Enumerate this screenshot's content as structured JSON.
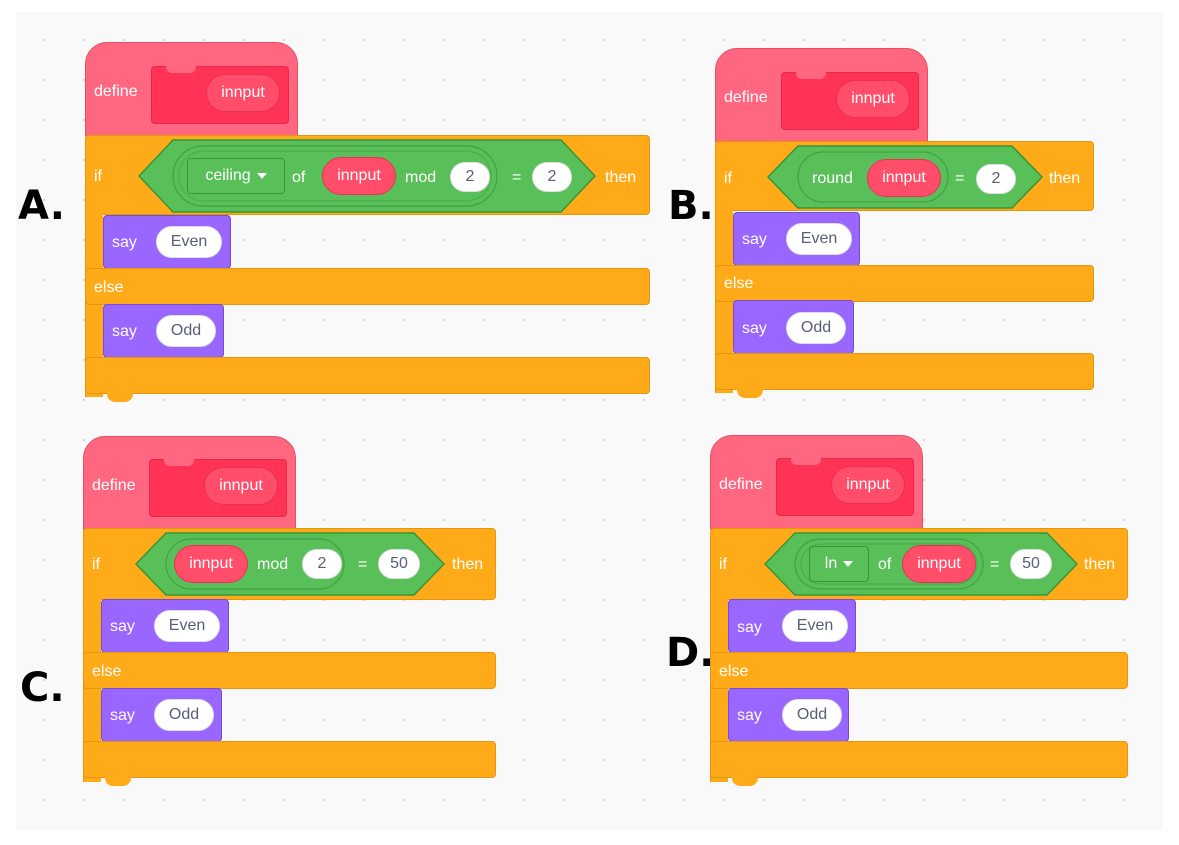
{
  "options": [
    {
      "letter": "A.",
      "define": "define",
      "param": "innput",
      "if": "if",
      "then": "then",
      "else": "else",
      "say1": "say",
      "even": "Even",
      "say2": "say",
      "odd": "Odd",
      "cond": {
        "func": "ceiling",
        "of": "of",
        "arg": "innput",
        "mod": "mod",
        "modval": "2",
        "eq": "=",
        "rhs": "2"
      }
    },
    {
      "letter": "B.",
      "define": "define",
      "param": "innput",
      "if": "if",
      "then": "then",
      "else": "else",
      "say1": "say",
      "even": "Even",
      "say2": "say",
      "odd": "Odd",
      "cond": {
        "func": "round",
        "arg": "innput",
        "eq": "=",
        "rhs": "2"
      }
    },
    {
      "letter": "C.",
      "define": "define",
      "param": "innput",
      "if": "if",
      "then": "then",
      "else": "else",
      "say1": "say",
      "even": "Even",
      "say2": "say",
      "odd": "Odd",
      "cond": {
        "arg": "innput",
        "mod": "mod",
        "modval": "2",
        "eq": "=",
        "rhs": "50"
      }
    },
    {
      "letter": "D.",
      "define": "define",
      "param": "innput",
      "if": "if",
      "then": "then",
      "else": "else",
      "say1": "say",
      "even": "Even",
      "say2": "say",
      "odd": "Odd",
      "cond": {
        "func": "ln",
        "of": "of",
        "arg": "innput",
        "eq": "=",
        "rhs": "50"
      }
    }
  ],
  "colors": {
    "define": "#ff6680",
    "param": "#ff4d6a",
    "control": "#ffab19",
    "operator": "#59c059",
    "looks": "#9966ff"
  }
}
